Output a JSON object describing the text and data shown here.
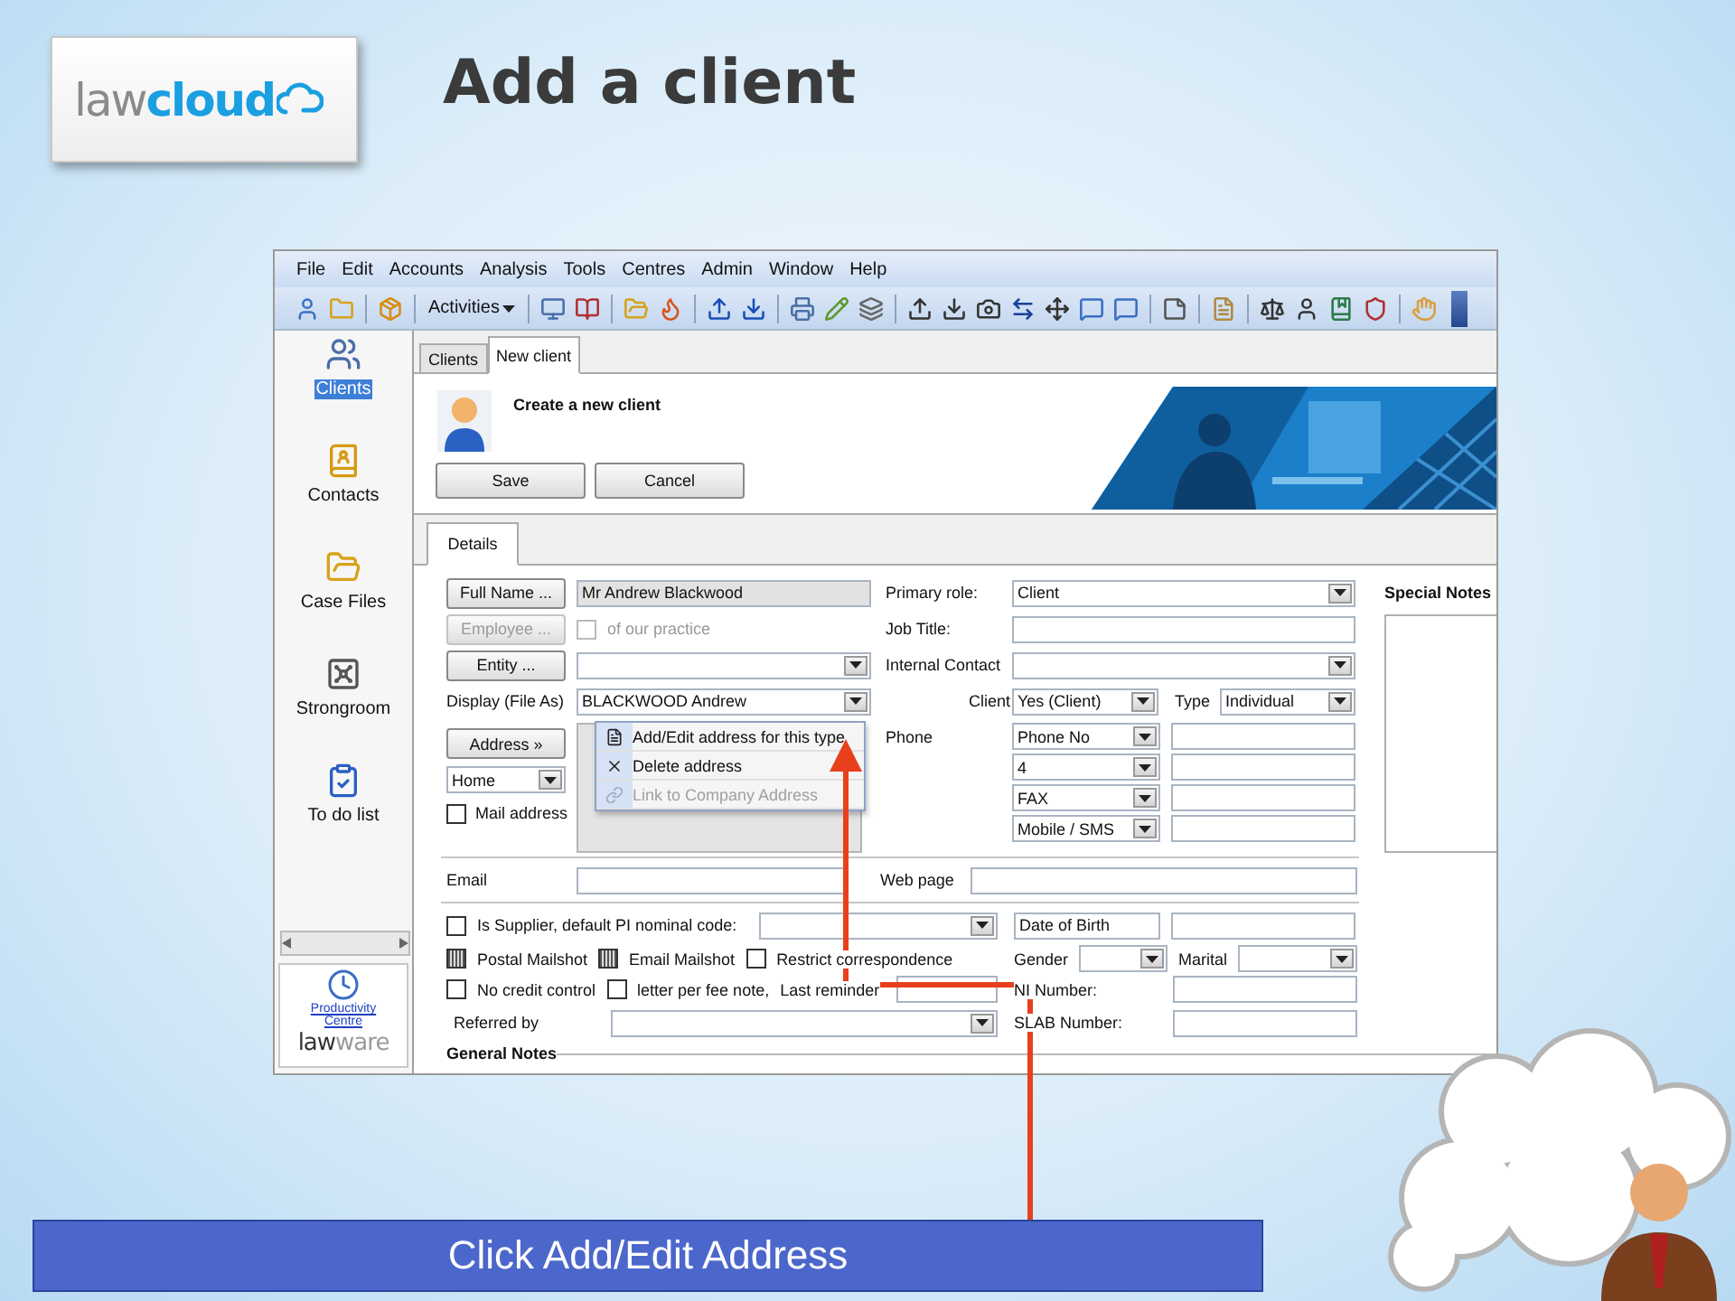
{
  "slide": {
    "logo": {
      "light": "law",
      "bold": "cloud"
    },
    "title": "Add a client",
    "caption": "Click Add/Edit Address"
  },
  "app": {
    "menu": [
      "File",
      "Edit",
      "Accounts",
      "Analysis",
      "Tools",
      "Centres",
      "Admin",
      "Window",
      "Help"
    ],
    "toolbar": {
      "activities": "Activities"
    },
    "sidebar": {
      "items": [
        {
          "label": "Clients",
          "selected": true
        },
        {
          "label": "Contacts",
          "selected": false
        },
        {
          "label": "Case Files",
          "selected": false
        },
        {
          "label": "Strongroom",
          "selected": false
        },
        {
          "label": "To do list",
          "selected": false
        }
      ],
      "link": "Productivity Centre",
      "brand": {
        "dark": "law",
        "light": "ware"
      }
    },
    "tabs": [
      {
        "label": "Clients",
        "selected": false
      },
      {
        "label": "New client",
        "selected": true
      }
    ],
    "header": {
      "title": "Create a new client",
      "buttons": [
        "Save",
        "Cancel"
      ]
    },
    "detail_tabs": [
      {
        "label": "Details",
        "selected": true
      }
    ],
    "form": {
      "full_name": {
        "button": "Full Name ...",
        "value": "Mr Andrew  Blackwood"
      },
      "employee": {
        "button": "Employee ...",
        "disabled": true,
        "label": "of our practice",
        "checked": false
      },
      "entity": {
        "button": "Entity ..."
      },
      "display": {
        "label": "Display (File As)",
        "value": "BLACKWOOD Andrew"
      },
      "address": {
        "button": "Address »",
        "type": "Home",
        "mail_label": "Mail address",
        "mail_checked": false
      },
      "primary_role": {
        "label": "Primary role:",
        "value": "Client"
      },
      "job_title": {
        "label": "Job Title:"
      },
      "internal_contact": {
        "label": "Internal Contact"
      },
      "client": {
        "label": "Client",
        "value": "Yes (Client)"
      },
      "type": {
        "label": "Type",
        "value": "Individual"
      },
      "phone": {
        "label": "Phone",
        "rows": [
          {
            "type": "Phone No"
          },
          {
            "type": "4"
          },
          {
            "type": "FAX"
          },
          {
            "type": "Mobile / SMS"
          }
        ]
      },
      "special_notes": {
        "label": "Special Notes"
      },
      "email": {
        "label": "Email"
      },
      "web_page": {
        "label": "Web page"
      },
      "supplier": {
        "label": "Is Supplier, default PI nominal code:",
        "checked": false
      },
      "date_of_birth": {
        "label": "Date of Birth"
      },
      "mailshots": [
        {
          "label": "Postal Mailshot",
          "indeterminate": true
        },
        {
          "label": "Email Mailshot",
          "indeterminate": true
        },
        {
          "label": "Restrict correspondence",
          "indeterminate": false
        }
      ],
      "gender": {
        "label": "Gender"
      },
      "marital": {
        "label": "Marital"
      },
      "credit": [
        {
          "label": "No credit control",
          "checked": false
        },
        {
          "label": "letter per fee note,",
          "checked": false
        }
      ],
      "last_reminder": {
        "label": "Last reminder"
      },
      "ni_number": {
        "label": "NI Number:"
      },
      "referred_by": {
        "label": "Referred by"
      },
      "slab_number": {
        "label": "SLAB Number:"
      },
      "general_notes": {
        "label": "General Notes"
      }
    },
    "context_menu": [
      {
        "label": "Add/Edit address for this type",
        "disabled": false
      },
      {
        "label": "Delete address",
        "disabled": false
      },
      {
        "label": "Link to Company Address",
        "disabled": true
      }
    ]
  }
}
